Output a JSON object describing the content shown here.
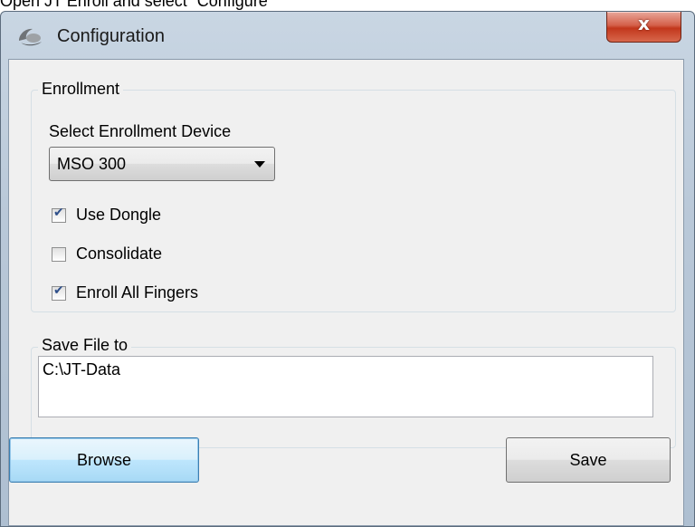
{
  "caption": "Open JT Enroll and select “Configure”",
  "window": {
    "title": "Configuration",
    "close_glyph": "x",
    "icon": "app-logo-icon"
  },
  "enrollment": {
    "legend": "Enrollment",
    "device_label": "Select Enrollment Device",
    "device_value": "MSO 300",
    "checkboxes": [
      {
        "label": "Use Dongle",
        "checked": true
      },
      {
        "label": "Consolidate",
        "checked": false
      },
      {
        "label": "Enroll All Fingers",
        "checked": true
      }
    ]
  },
  "save": {
    "legend": "Save File to",
    "path_value": "C:\\JT-Data"
  },
  "buttons": {
    "browse_label": "Browse",
    "save_label": "Save"
  },
  "colors": {
    "close_button": "#c2371c",
    "focused_button_border": "#3c7fb1",
    "check_mark": "#2e4f8a"
  }
}
